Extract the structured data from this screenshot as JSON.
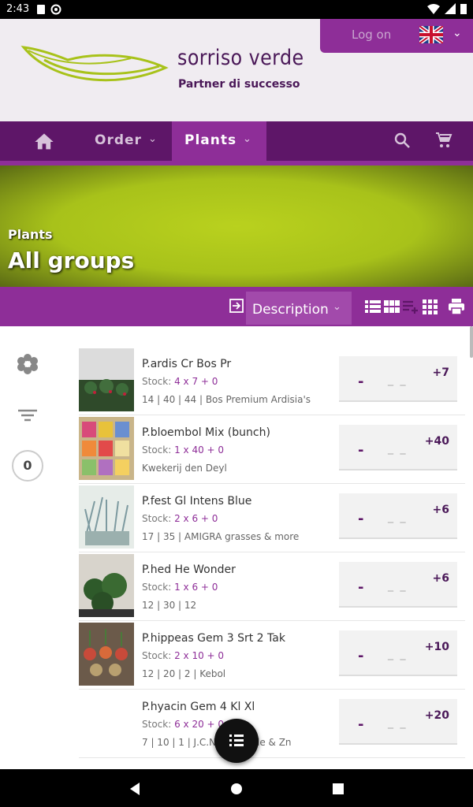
{
  "status_bar": {
    "time": "2:43"
  },
  "header": {
    "brand_name": "sorriso verde",
    "tagline": "Partner di successo",
    "login_label": "Log on",
    "language_flag": "uk-flag-icon",
    "colors": {
      "brand": "#4a1858",
      "accent": "#8e2e98",
      "leaf": "#a8c21a"
    }
  },
  "nav": {
    "home_icon": "home-icon",
    "order_label": "Order",
    "plants_label": "Plants",
    "search_icon": "search-icon",
    "cart_icon": "cart-icon"
  },
  "banner": {
    "subtitle": "Plants",
    "title": "All groups"
  },
  "toolbar": {
    "sort_label": "Description",
    "icons": [
      "export-icon",
      "list-view-icon",
      "grid-view-icon",
      "playlist-add-icon",
      "compact-grid-icon",
      "print-icon"
    ]
  },
  "sidebar": {
    "icons": [
      "flower-icon",
      "filter-icon"
    ],
    "count": "0"
  },
  "products": [
    {
      "name": "P.ardis Cr Bos Pr",
      "stock_label": "Stock:",
      "stock": "4 x 7 + 0",
      "meta": "14 | 40 | 44 | Bos Premium Ardisia's",
      "qty_minus": "-",
      "qty_value": "_ _",
      "qty_plus": "+7"
    },
    {
      "name": "P.bloembol Mix (bunch)",
      "stock_label": "Stock:",
      "stock": "1 x 40 + 0",
      "meta": "Kwekerij den Deyl",
      "qty_minus": "-",
      "qty_value": "_ _",
      "qty_plus": "+40"
    },
    {
      "name": "P.fest Gl Intens Blue",
      "stock_label": "Stock:",
      "stock": "2 x 6 + 0",
      "meta": "17 | 35 | AMIGRA grasses & more",
      "qty_minus": "-",
      "qty_value": "_ _",
      "qty_plus": "+6"
    },
    {
      "name": "P.hed He Wonder",
      "stock_label": "Stock:",
      "stock": "1 x 6 + 0",
      "meta": "12 | 30 | 12",
      "qty_minus": "-",
      "qty_value": "_ _",
      "qty_plus": "+6"
    },
    {
      "name": "P.hippeas Gem 3 Srt 2 Tak",
      "stock_label": "Stock:",
      "stock": "2 x 10 + 0",
      "meta": "12 | 20 | 2 | Kebol",
      "qty_minus": "-",
      "qty_value": "_ _",
      "qty_plus": "+10"
    },
    {
      "name": "P.hyacin Gem 4 Kl Xl",
      "stock_label": "Stock:",
      "stock": "6 x 20 + 0",
      "meta": "7 | 10 | 1 | J.C.N. ... woude & Zn",
      "qty_minus": "-",
      "qty_value": "_ _",
      "qty_plus": "+20"
    }
  ],
  "fab": {
    "icon": "list-icon"
  }
}
